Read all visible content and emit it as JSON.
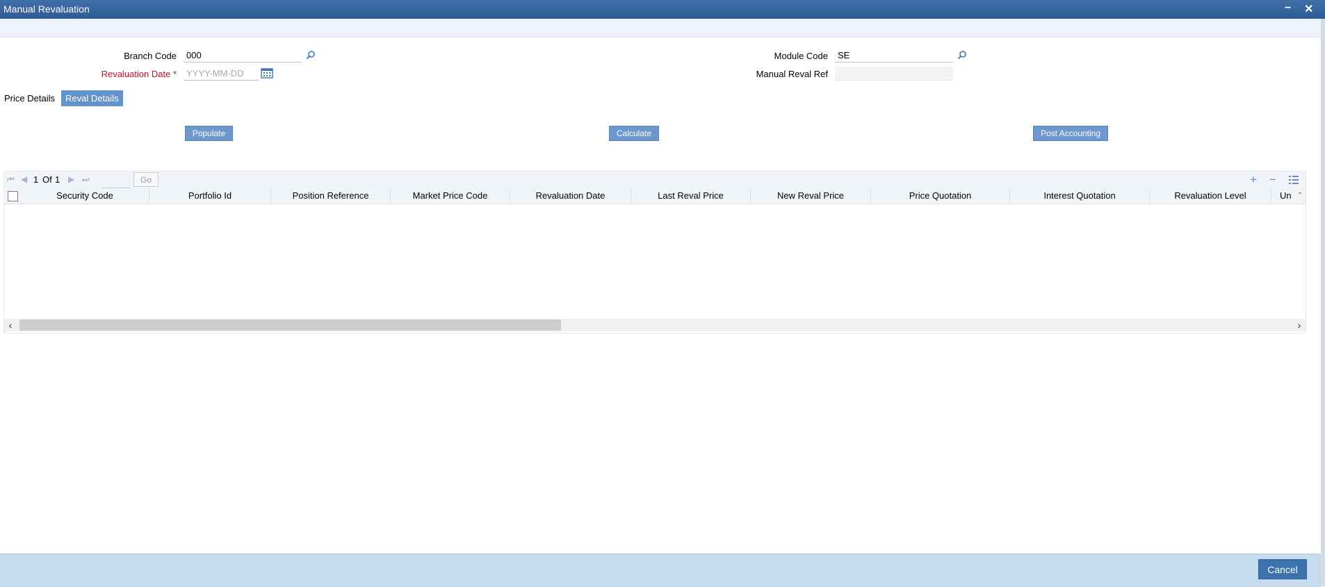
{
  "window": {
    "title": "Manual Revaluation",
    "minimize_glyph": "−",
    "close_glyph": "✕"
  },
  "form": {
    "branch_code": {
      "label": "Branch Code",
      "value": "000"
    },
    "revaluation_date": {
      "label": "Revaluation Date",
      "required_mark": "*",
      "placeholder": "YYYY-MM-DD",
      "value": ""
    },
    "module_code": {
      "label": "Module Code",
      "value": "SE"
    },
    "manual_reval_ref": {
      "label": "Manual Reval Ref",
      "value": ""
    }
  },
  "tabs": [
    {
      "label": "Price Details",
      "active": false
    },
    {
      "label": "Reval Details",
      "active": true
    }
  ],
  "actions": {
    "populate": "Populate",
    "calculate": "Calculate",
    "post_accounting": "Post Accounting"
  },
  "grid": {
    "pager": {
      "current": "1",
      "of_label": "Of",
      "total": "1",
      "go_label": "Go"
    },
    "columns": [
      "Security Code",
      "Portfolio Id",
      "Position Reference",
      "Market Price Code",
      "Revaluation Date",
      "Last Reval Price",
      "New Reval Price",
      "Price Quotation",
      "Interest Quotation",
      "Revaluation Level",
      "Un"
    ],
    "rows": []
  },
  "footer": {
    "cancel_label": "Cancel"
  },
  "colors": {
    "title_bar": "#3f6fa9",
    "required_label": "#c8141e",
    "button": "#6d97cf",
    "footer": "#c7dbef",
    "cancel_button": "#3c72ad"
  },
  "icons": {
    "lookup": "magnifier-icon",
    "calendar": "calendar-icon",
    "add": "plus-icon",
    "remove": "minus-icon",
    "columns": "list-columns-icon"
  }
}
